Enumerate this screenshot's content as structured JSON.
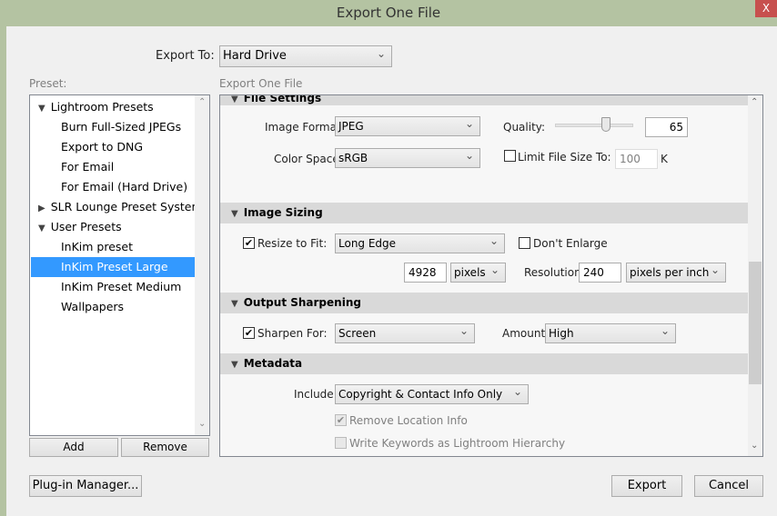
{
  "window": {
    "title": "Export One File",
    "close": "X"
  },
  "export_to": {
    "label": "Export To:",
    "value": "Hard Drive"
  },
  "preset": {
    "label": "Preset:",
    "groups": [
      {
        "name": "Lightroom Presets",
        "expanded": true,
        "items": [
          "Burn Full-Sized JPEGs",
          "Export to DNG",
          "For Email",
          "For Email (Hard Drive)"
        ]
      },
      {
        "name": "SLR Lounge Preset System",
        "expanded": false,
        "items": []
      },
      {
        "name": "User Presets",
        "expanded": true,
        "items": [
          "InKim preset",
          "InKim Preset Large",
          "InKim Preset Medium",
          "Wallpapers"
        ]
      }
    ],
    "selected": "InKim Preset Large",
    "add": "Add",
    "remove": "Remove"
  },
  "panel": {
    "label": "Export One File",
    "file_settings": {
      "title": "File Settings",
      "format_label": "Image Format:",
      "format": "JPEG",
      "quality_label": "Quality:",
      "quality": "65",
      "quality_value": 65,
      "color_space_label": "Color Space:",
      "color_space": "sRGB",
      "limit_label": "Limit File Size To:",
      "limit_checked": false,
      "limit_value": "100",
      "limit_unit": "K"
    },
    "image_sizing": {
      "title": "Image Sizing",
      "resize_label": "Resize to Fit:",
      "resize_checked": true,
      "resize_mode": "Long Edge",
      "dont_enlarge": "Don't Enlarge",
      "dont_enlarge_checked": false,
      "size": "4928",
      "size_unit": "pixels",
      "resolution_label": "Resolution:",
      "resolution": "240",
      "resolution_unit": "pixels per inch"
    },
    "output_sharpening": {
      "title": "Output Sharpening",
      "sharpen_label": "Sharpen For:",
      "sharpen_checked": true,
      "sharpen_for": "Screen",
      "amount_label": "Amount:",
      "amount": "High"
    },
    "metadata": {
      "title": "Metadata",
      "include_label": "Include:",
      "include": "Copyright & Contact Info Only",
      "remove_location": "Remove Location Info",
      "remove_location_checked": true,
      "write_keywords": "Write Keywords as Lightroom Hierarchy",
      "write_keywords_checked": false
    }
  },
  "footer": {
    "plugin_manager": "Plug-in Manager...",
    "export": "Export",
    "cancel": "Cancel"
  }
}
